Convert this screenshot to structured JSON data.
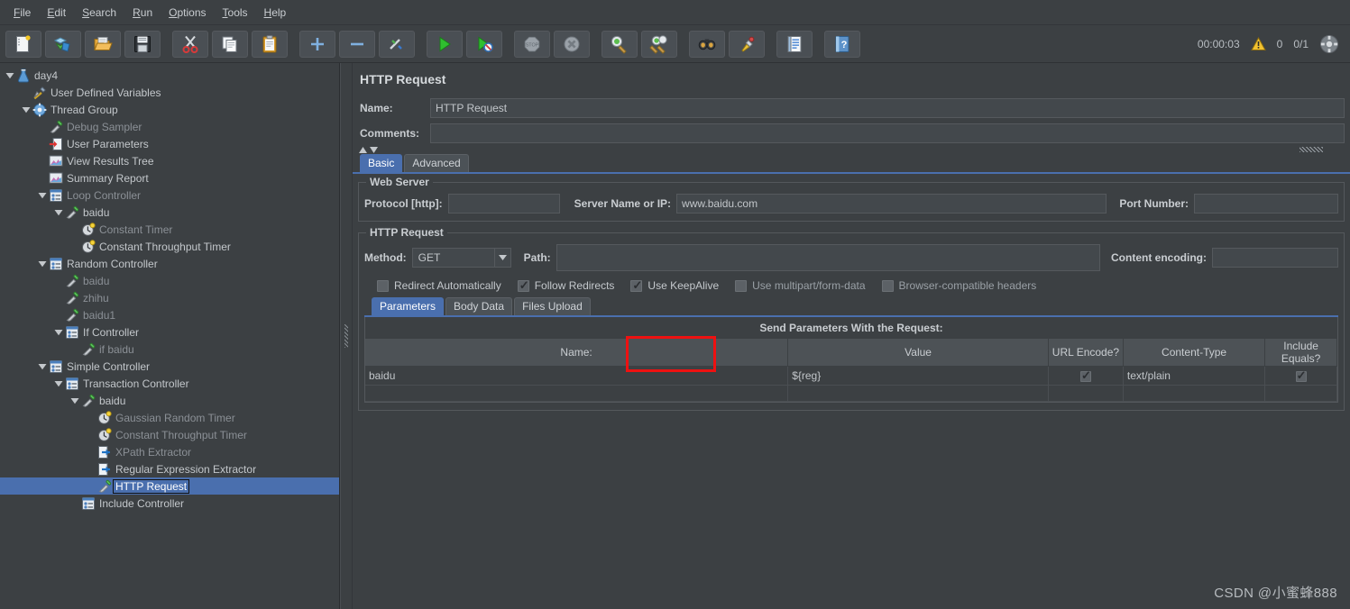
{
  "menubar": {
    "items": [
      {
        "label": "File",
        "mnemonic": "F"
      },
      {
        "label": "Edit",
        "mnemonic": "E"
      },
      {
        "label": "Search",
        "mnemonic": "S"
      },
      {
        "label": "Run",
        "mnemonic": "R"
      },
      {
        "label": "Options",
        "mnemonic": "O"
      },
      {
        "label": "Tools",
        "mnemonic": "T"
      },
      {
        "label": "Help",
        "mnemonic": "H"
      }
    ]
  },
  "toolbar": {
    "buttons": [
      {
        "name": "new-icon",
        "tooltip": "New"
      },
      {
        "name": "templates-icon",
        "tooltip": "Templates"
      },
      {
        "name": "open-icon",
        "tooltip": "Open"
      },
      {
        "name": "save-icon",
        "tooltip": "Save Test Plan"
      },
      {
        "name": "cut-icon",
        "tooltip": "Cut"
      },
      {
        "name": "copy-icon",
        "tooltip": "Copy"
      },
      {
        "name": "paste-icon",
        "tooltip": "Paste"
      },
      {
        "name": "expand-all-icon",
        "tooltip": "Expand All"
      },
      {
        "name": "collapse-all-icon",
        "tooltip": "Collapse All"
      },
      {
        "name": "toggle-icon",
        "tooltip": "Toggle"
      },
      {
        "name": "start-icon",
        "tooltip": "Start"
      },
      {
        "name": "start-no-pause-icon",
        "tooltip": "Start no pauses"
      },
      {
        "name": "stop-icon",
        "tooltip": "Stop"
      },
      {
        "name": "shutdown-icon",
        "tooltip": "Shutdown"
      },
      {
        "name": "clear-icon",
        "tooltip": "Clear"
      },
      {
        "name": "clear-all-icon",
        "tooltip": "Clear All"
      },
      {
        "name": "search-icon",
        "tooltip": "Search"
      },
      {
        "name": "reset-search-icon",
        "tooltip": "Reset Search"
      },
      {
        "name": "function-helper-icon",
        "tooltip": "Function Helper Dialog"
      },
      {
        "name": "help-icon",
        "tooltip": "Help"
      }
    ],
    "status": {
      "elapsed": "00:00:03",
      "warning_count": "0",
      "threads": "0/1",
      "connect_icon": "remote-status-icon"
    }
  },
  "tree": {
    "nodes": [
      {
        "label": "day4",
        "depth": 0,
        "toggle": "open",
        "icon": "testplan-icon",
        "dim": false,
        "selected": false
      },
      {
        "label": "User Defined Variables",
        "depth": 1,
        "toggle": "none",
        "icon": "config-icon",
        "dim": false,
        "selected": false
      },
      {
        "label": "Thread Group",
        "depth": 1,
        "toggle": "open",
        "icon": "threadgroup-icon",
        "dim": false,
        "selected": false
      },
      {
        "label": "Debug Sampler",
        "depth": 2,
        "toggle": "none",
        "icon": "sampler-icon",
        "dim": true,
        "selected": false
      },
      {
        "label": "User Parameters",
        "depth": 2,
        "toggle": "none",
        "icon": "preproc-icon",
        "dim": false,
        "selected": false
      },
      {
        "label": "View Results Tree",
        "depth": 2,
        "toggle": "none",
        "icon": "listener-icon",
        "dim": false,
        "selected": false
      },
      {
        "label": "Summary Report",
        "depth": 2,
        "toggle": "none",
        "icon": "listener-icon",
        "dim": false,
        "selected": false
      },
      {
        "label": "Loop Controller",
        "depth": 2,
        "toggle": "open",
        "icon": "controller-icon",
        "dim": true,
        "selected": false
      },
      {
        "label": "baidu",
        "depth": 3,
        "toggle": "open",
        "icon": "sampler-icon",
        "dim": false,
        "selected": false
      },
      {
        "label": "Constant Timer",
        "depth": 4,
        "toggle": "none",
        "icon": "timer-icon",
        "dim": true,
        "selected": false
      },
      {
        "label": "Constant Throughput Timer",
        "depth": 4,
        "toggle": "none",
        "icon": "timer-icon",
        "dim": false,
        "selected": false
      },
      {
        "label": "Random Controller",
        "depth": 2,
        "toggle": "open",
        "icon": "controller-icon",
        "dim": false,
        "selected": false
      },
      {
        "label": "baidu",
        "depth": 3,
        "toggle": "none",
        "icon": "sampler-icon",
        "dim": true,
        "selected": false
      },
      {
        "label": "zhihu",
        "depth": 3,
        "toggle": "none",
        "icon": "sampler-icon",
        "dim": true,
        "selected": false
      },
      {
        "label": "baidu1",
        "depth": 3,
        "toggle": "none",
        "icon": "sampler-icon",
        "dim": true,
        "selected": false
      },
      {
        "label": "If Controller",
        "depth": 3,
        "toggle": "open",
        "icon": "controller-icon",
        "dim": false,
        "selected": false
      },
      {
        "label": "if baidu",
        "depth": 4,
        "toggle": "none",
        "icon": "sampler-icon",
        "dim": true,
        "selected": false
      },
      {
        "label": "Simple Controller",
        "depth": 2,
        "toggle": "open",
        "icon": "controller-icon",
        "dim": false,
        "selected": false
      },
      {
        "label": "Transaction Controller",
        "depth": 3,
        "toggle": "open",
        "icon": "controller-icon",
        "dim": false,
        "selected": false
      },
      {
        "label": "baidu",
        "depth": 4,
        "toggle": "open",
        "icon": "sampler-icon",
        "dim": false,
        "selected": false
      },
      {
        "label": "Gaussian Random Timer",
        "depth": 5,
        "toggle": "none",
        "icon": "timer-icon",
        "dim": true,
        "selected": false
      },
      {
        "label": "Constant Throughput Timer",
        "depth": 5,
        "toggle": "none",
        "icon": "timer-icon",
        "dim": true,
        "selected": false
      },
      {
        "label": "XPath Extractor",
        "depth": 5,
        "toggle": "none",
        "icon": "postproc-icon",
        "dim": true,
        "selected": false
      },
      {
        "label": "Regular Expression Extractor",
        "depth": 5,
        "toggle": "none",
        "icon": "postproc-icon",
        "dim": false,
        "selected": false
      },
      {
        "label": "HTTP Request",
        "depth": 5,
        "toggle": "none",
        "icon": "sampler-icon",
        "dim": false,
        "selected": true
      },
      {
        "label": "Include Controller",
        "depth": 4,
        "toggle": "none",
        "icon": "controller-icon",
        "dim": false,
        "selected": false
      }
    ]
  },
  "editor": {
    "title": "HTTP Request",
    "name_label": "Name:",
    "name_value": "HTTP Request",
    "comments_label": "Comments:",
    "comments_value": "",
    "tabs": [
      {
        "label": "Basic",
        "active": true
      },
      {
        "label": "Advanced",
        "active": false
      }
    ],
    "web_server": {
      "group_title": "Web Server",
      "protocol_label": "Protocol [http]:",
      "protocol_value": "",
      "server_label": "Server Name or IP:",
      "server_value": "www.baidu.com",
      "port_label": "Port Number:",
      "port_value": ""
    },
    "http_request": {
      "group_title": "HTTP Request",
      "method_label": "Method:",
      "method_value": "GET",
      "path_label": "Path:",
      "path_value": "",
      "content_encoding_label": "Content encoding:",
      "content_encoding_value": "",
      "checkboxes": [
        {
          "label": "Redirect Automatically",
          "checked": false,
          "dim": false
        },
        {
          "label": "Follow Redirects",
          "checked": true,
          "dim": false
        },
        {
          "label": "Use KeepAlive",
          "checked": true,
          "dim": false
        },
        {
          "label": "Use multipart/form-data",
          "checked": false,
          "dim": true
        },
        {
          "label": "Browser-compatible headers",
          "checked": false,
          "dim": true
        }
      ],
      "subtabs": [
        {
          "label": "Parameters",
          "active": true
        },
        {
          "label": "Body Data",
          "active": false
        },
        {
          "label": "Files Upload",
          "active": false
        }
      ]
    },
    "params_table": {
      "caption": "Send Parameters With the Request:",
      "columns": [
        "Name:",
        "Value",
        "URL Encode?",
        "Content-Type",
        "Include Equals?"
      ],
      "rows": [
        {
          "name": "baidu",
          "value": "${reg}",
          "url_encode": true,
          "content_type": "text/plain",
          "include_equals": true
        }
      ]
    }
  },
  "annotation": {
    "target": "${reg}",
    "color": "#ee1111"
  },
  "watermark": "CSDN @小蜜蜂888"
}
